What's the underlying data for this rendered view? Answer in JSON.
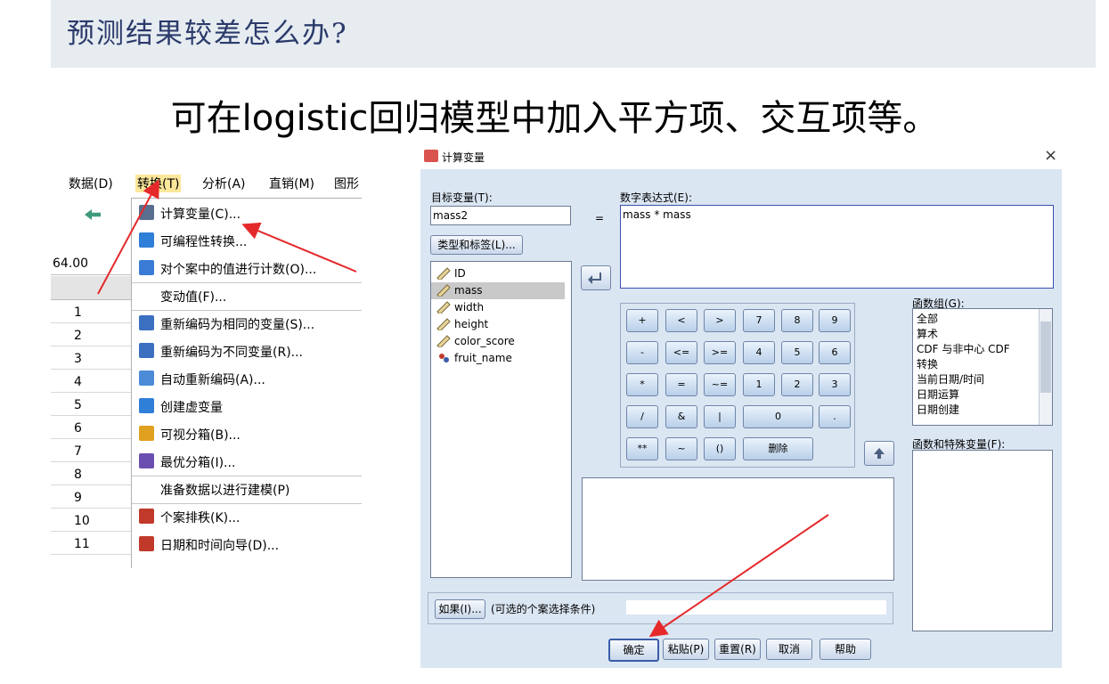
{
  "slide": {
    "title": "预测结果较差怎么办?",
    "subtitle": "可在logistic回归模型中加入平方项、交互项等。"
  },
  "left_menu": {
    "menubar": [
      "数据(D)",
      "转换(T)",
      "分析(A)",
      "直销(M)",
      "图形"
    ],
    "cell_value": "64.00",
    "row_numbers": [
      "1",
      "2",
      "3",
      "4",
      "5",
      "6",
      "7",
      "8",
      "9",
      "10",
      "11"
    ],
    "items": [
      {
        "label": "计算变量(C)...",
        "icon": "calculator-variable-icon"
      },
      {
        "label": "可编程性转换...",
        "icon": "plus-icon"
      },
      {
        "label": "对个案中的值进行计数(O)...",
        "icon": "count-values-icon"
      },
      {
        "label": "变动值(F)...",
        "icon": ""
      },
      {
        "label": "重新编码为相同的变量(S)...",
        "icon": "recode-same-icon"
      },
      {
        "label": "重新编码为不同变量(R)...",
        "icon": "recode-different-icon"
      },
      {
        "label": "自动重新编码(A)...",
        "icon": "auto-recode-icon"
      },
      {
        "label": "创建虚变量",
        "icon": "plus-icon"
      },
      {
        "label": "可视分箱(B)...",
        "icon": "visual-binning-icon"
      },
      {
        "label": "最优分箱(I)...",
        "icon": "optimal-binning-icon"
      },
      {
        "label": "准备数据以进行建模(P)",
        "icon": ""
      },
      {
        "label": "个案排秩(K)...",
        "icon": "rank-cases-icon"
      },
      {
        "label": "日期和时间向导(D)...",
        "icon": "calendar-icon"
      }
    ]
  },
  "dialog": {
    "title": "计算变量",
    "target_label": "目标变量(T):",
    "target_value": "mass2",
    "equals": "=",
    "expr_label": "数字表达式(E):",
    "expr_value": "mass * mass",
    "type_label_button": "类型和标签(L)...",
    "variables": [
      {
        "name": "ID",
        "icon": "scale-ruler-icon"
      },
      {
        "name": "mass",
        "icon": "scale-ruler-icon",
        "selected": true
      },
      {
        "name": "width",
        "icon": "scale-ruler-icon"
      },
      {
        "name": "height",
        "icon": "scale-ruler-icon"
      },
      {
        "name": "color_score",
        "icon": "scale-ruler-icon"
      },
      {
        "name": "fruit_name",
        "icon": "nominal-variable-icon"
      }
    ],
    "keypad": [
      [
        "+",
        "<",
        ">",
        "7",
        "8",
        "9"
      ],
      [
        "-",
        "<=",
        ">=",
        "4",
        "5",
        "6"
      ],
      [
        "*",
        "=",
        "~=",
        "1",
        "2",
        "3"
      ],
      [
        "/",
        "&",
        "|",
        "0",
        "."
      ],
      [
        "**",
        "~",
        "()",
        "删除"
      ]
    ],
    "func_group_label": "函数组(G):",
    "func_groups": [
      "全部",
      "算术",
      "CDF 与非中心 CDF",
      "转换",
      "当前日期/时间",
      "日期运算",
      "日期创建"
    ],
    "func_vars_label": "函数和特殊变量(F):",
    "if_button": "如果(I)...",
    "if_hint": "(可选的个案选择条件)",
    "buttons": [
      "确定",
      "粘贴(P)",
      "重置(R)",
      "取消",
      "帮助"
    ],
    "close_glyph": "×"
  },
  "colors": {
    "title": "#2b3a6b",
    "arrow": "#e5292b",
    "dialog_bg": "#dbe6f3"
  }
}
